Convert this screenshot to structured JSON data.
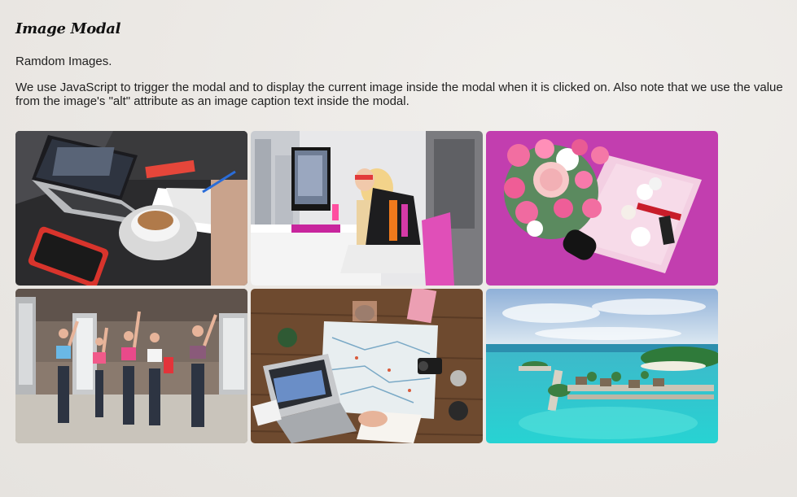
{
  "page": {
    "title": "Image Modal",
    "subtitle": "Ramdom Images.",
    "description": "We use JavaScript to trigger the modal and to display the current image inside the modal when it is clicked on. Also note that we use the value from the image's \"alt\" attribute as an image caption text inside the modal."
  },
  "gallery": {
    "images": [
      {
        "icon": "laptop-coffee-desk-photo"
      },
      {
        "icon": "woman-at-computer-photo"
      },
      {
        "icon": "roses-and-cosmetics-photo"
      },
      {
        "icon": "fitness-group-photo"
      },
      {
        "icon": "map-and-laptop-photo"
      },
      {
        "icon": "tropical-island-photo"
      }
    ]
  }
}
